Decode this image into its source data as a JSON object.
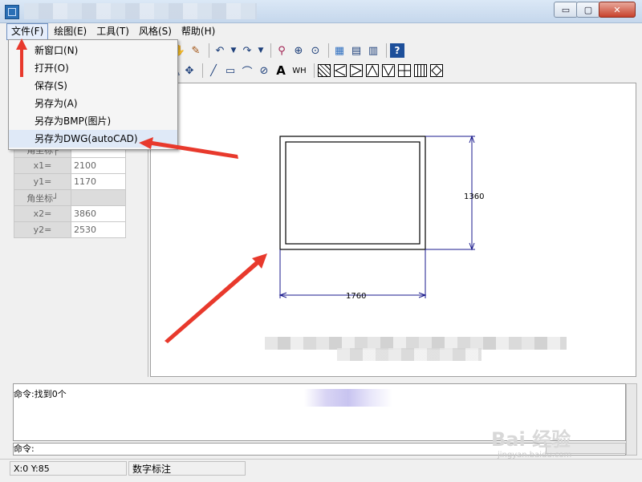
{
  "window": {
    "min_glyph": "▭",
    "max_glyph": "▢",
    "close_glyph": "✕"
  },
  "menubar": [
    {
      "label": "文件(F)"
    },
    {
      "label": "绘图(E)"
    },
    {
      "label": "工具(T)"
    },
    {
      "label": "风格(S)"
    },
    {
      "label": "帮助(H)"
    }
  ],
  "file_menu": {
    "items": [
      {
        "label": "新窗口(N)"
      },
      {
        "label": "打开(O)"
      },
      {
        "label": "保存(S)"
      },
      {
        "label": "另存为(A)"
      },
      {
        "label": "另存为BMP(图片)"
      },
      {
        "label": "另存为DWG(autoCAD)"
      }
    ]
  },
  "properties": {
    "partial_value": "1360",
    "rows": [
      {
        "label": "角坐标┌",
        "value": ""
      },
      {
        "label": "x1=",
        "value": "2100"
      },
      {
        "label": "y1=",
        "value": "1170"
      },
      {
        "label": "角坐标┘",
        "value": ""
      },
      {
        "label": "x2=",
        "value": "3860"
      },
      {
        "label": "y2=",
        "value": "2530"
      }
    ]
  },
  "drawing": {
    "dim_height": "1360",
    "dim_width": "1760"
  },
  "command": {
    "output": "命令:找到0个",
    "prompt": "命令:"
  },
  "status": {
    "coords": "X:0   Y:85",
    "mode": "数字标注"
  },
  "toolbar": {
    "text_tool": "A",
    "wh_tool": "WH",
    "help": "?"
  },
  "watermark": {
    "logo": "Bai 经验",
    "url": "jingyan.baidu.com"
  },
  "colors": {
    "dimension": "#1a1a8c",
    "arrow": "#e8392c",
    "titlebar": "#c5d7ec"
  }
}
